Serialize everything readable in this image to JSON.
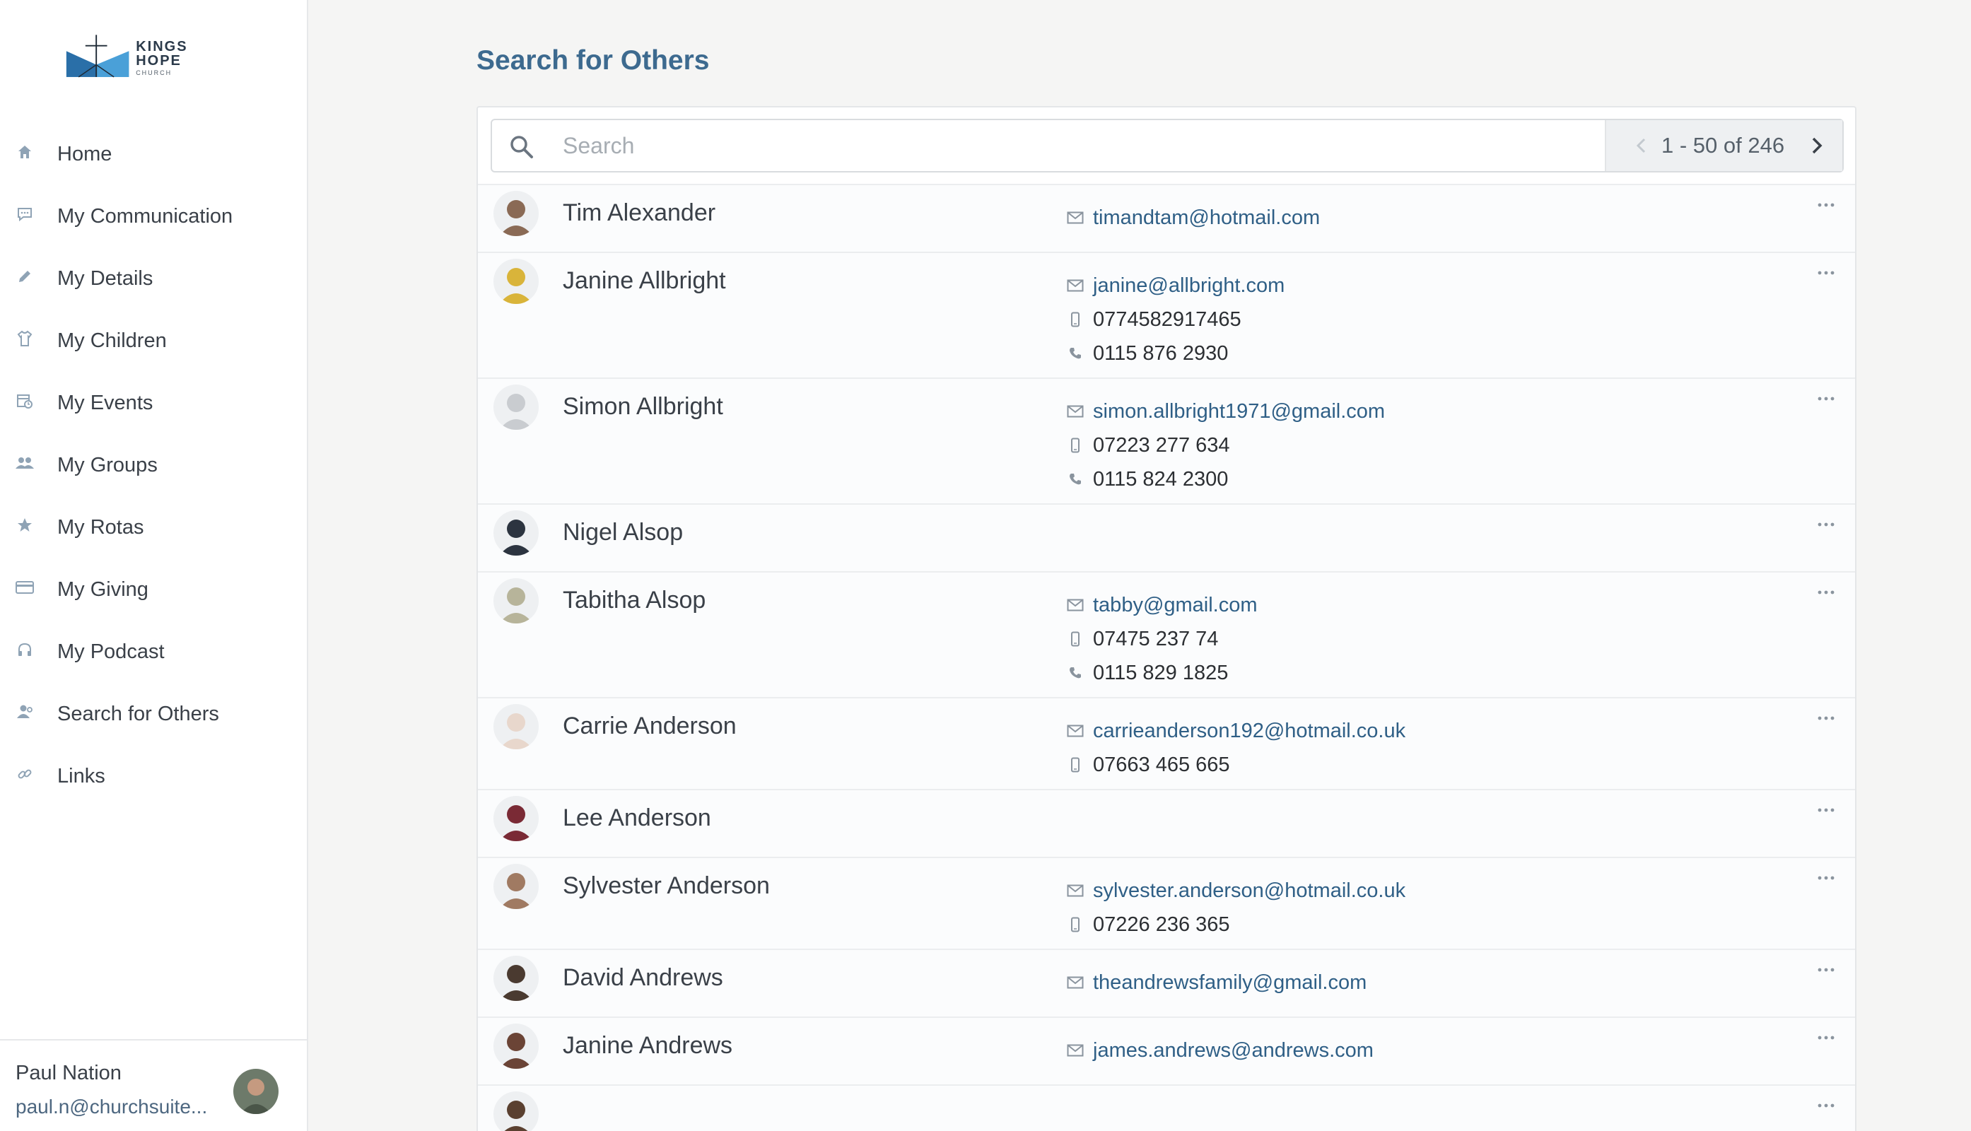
{
  "brand": {
    "name": "KINGS HOPE",
    "sub": "CHURCH"
  },
  "sidebar": {
    "items": [
      {
        "label": "Home",
        "icon": "home-icon"
      },
      {
        "label": "My Communication",
        "icon": "chat-icon"
      },
      {
        "label": "My Details",
        "icon": "pencil-icon"
      },
      {
        "label": "My Children",
        "icon": "shirt-icon"
      },
      {
        "label": "My Events",
        "icon": "calendar-icon"
      },
      {
        "label": "My Groups",
        "icon": "group-icon"
      },
      {
        "label": "My Rotas",
        "icon": "star-icon"
      },
      {
        "label": "My Giving",
        "icon": "card-icon"
      },
      {
        "label": "My Podcast",
        "icon": "headphones-icon"
      },
      {
        "label": "Search for Others",
        "icon": "person-search-icon"
      },
      {
        "label": "Links",
        "icon": "link-icon"
      }
    ]
  },
  "user": {
    "name": "Paul Nation",
    "email": "paul.n@churchsuite..."
  },
  "main": {
    "title": "Search for Others",
    "search": {
      "placeholder": "Search",
      "value": ""
    },
    "pager": {
      "text": "1 - 50 of 246"
    },
    "people": [
      {
        "name": "Tim Alexander",
        "email": "timandtam@hotmail.com",
        "mobile": "",
        "phone": "",
        "avatar_color": "#8a6a55"
      },
      {
        "name": "Janine Allbright",
        "email": "janine@allbright.com",
        "mobile": "0774582917465",
        "phone": "0115 876 2930",
        "avatar_color": "#d9b43a"
      },
      {
        "name": "Simon Allbright",
        "email": "simon.allbright1971@gmail.com",
        "mobile": "07223 277 634",
        "phone": "0115 824 2300",
        "avatar_color": "#c9ccd0"
      },
      {
        "name": "Nigel Alsop",
        "email": "",
        "mobile": "",
        "phone": "",
        "avatar_color": "#2c3440"
      },
      {
        "name": "Tabitha Alsop",
        "email": "tabby@gmail.com",
        "mobile": "07475 237 74",
        "phone": "0115 829 1825",
        "avatar_color": "#b7b49a"
      },
      {
        "name": "Carrie Anderson",
        "email": "carrieanderson192@hotmail.co.uk",
        "mobile": "07663 465 665",
        "phone": "",
        "avatar_color": "#e8d7cc"
      },
      {
        "name": "Lee Anderson",
        "email": "",
        "mobile": "",
        "phone": "",
        "avatar_color": "#7a2a35"
      },
      {
        "name": "Sylvester Anderson",
        "email": "sylvester.anderson@hotmail.co.uk",
        "mobile": "07226 236 365",
        "phone": "",
        "avatar_color": "#a07a62"
      },
      {
        "name": "David Andrews",
        "email": "theandrewsfamily@gmail.com",
        "mobile": "",
        "phone": "",
        "avatar_color": "#4a3a30"
      },
      {
        "name": "Janine Andrews",
        "email": "james.andrews@andrews.com",
        "mobile": "",
        "phone": "",
        "avatar_color": "#6b4436"
      },
      {
        "name": "",
        "email": "",
        "mobile": "",
        "phone": "",
        "avatar_color": "#5a4030"
      }
    ]
  },
  "colors": {
    "accent": "#3d6a8f",
    "link": "#2f5f86",
    "icon": "#8fa3b5"
  }
}
